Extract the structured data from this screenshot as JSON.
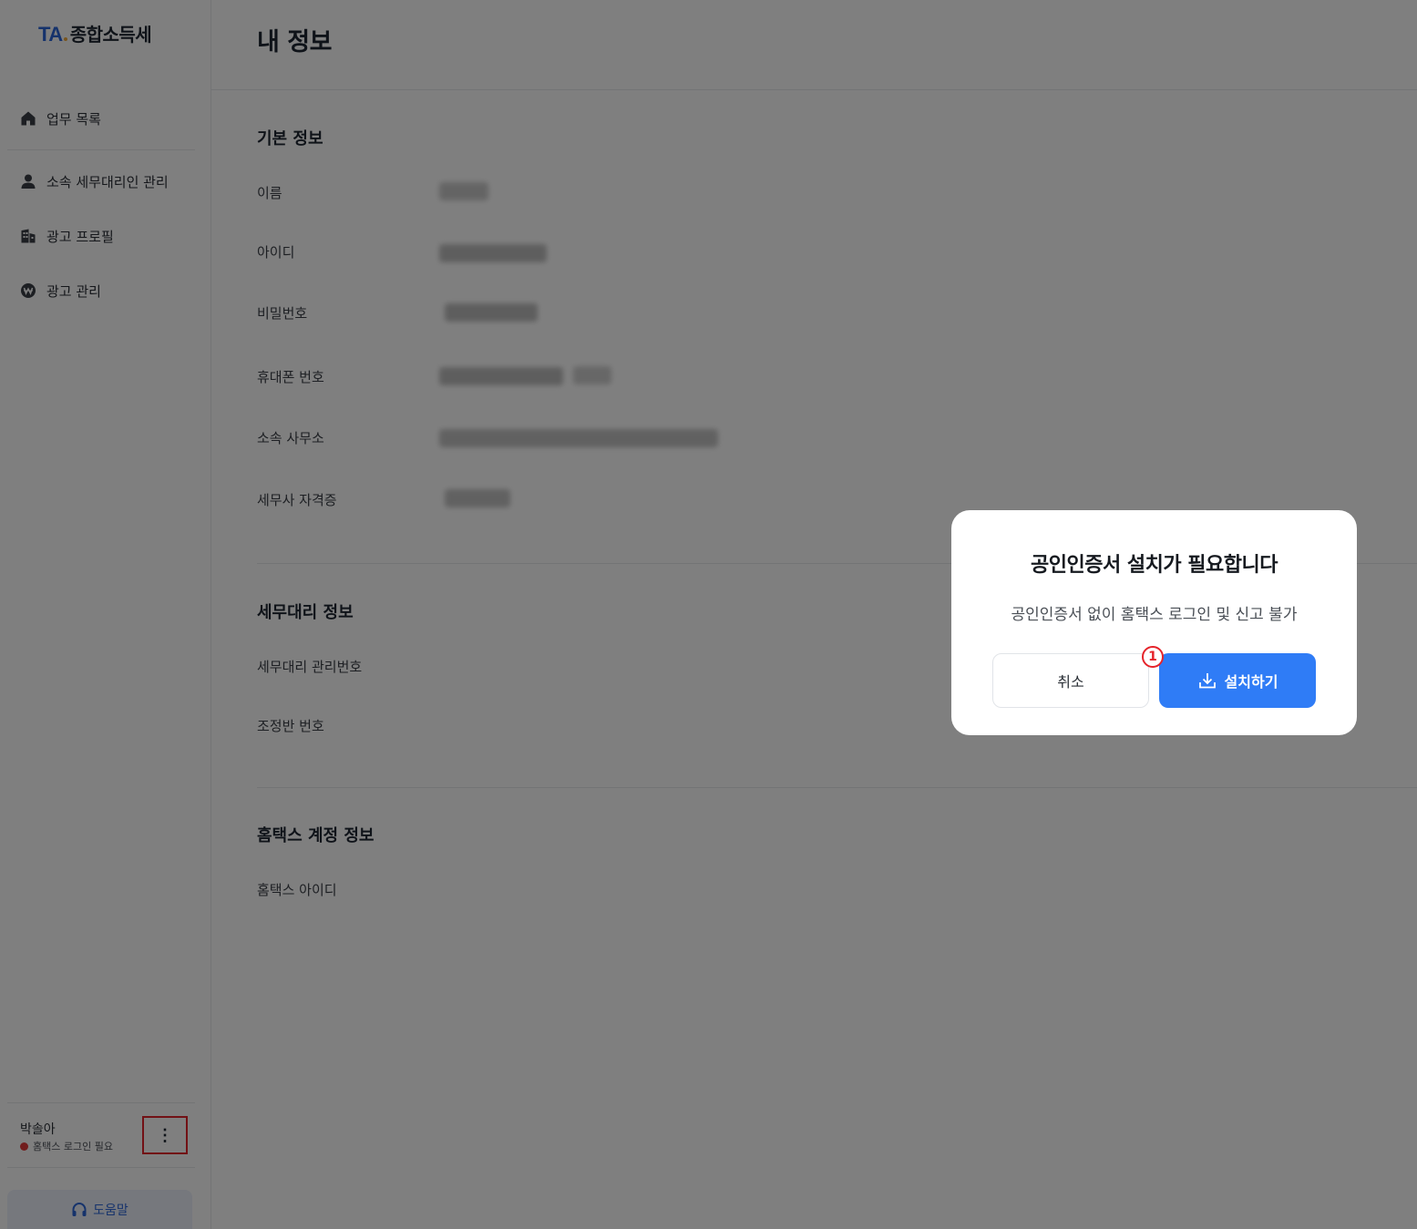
{
  "sidebar": {
    "logo_ta": "TA",
    "logo_name": "종합소득세",
    "items": [
      {
        "label": "업무 목록",
        "icon": "home-icon"
      },
      {
        "label": "소속 세무대리인 관리",
        "icon": "person-icon"
      },
      {
        "label": "광고 프로필",
        "icon": "building-icon"
      },
      {
        "label": "광고 관리",
        "icon": "won-coin-icon"
      }
    ],
    "user": {
      "name": "박솔아",
      "status": "홈택스 로그인 필요",
      "status_color": "#e23b3b",
      "more_icon": "⋮"
    },
    "help_label": "도움말"
  },
  "main": {
    "page_title": "내 정보",
    "sections": [
      {
        "title": "기본 정보",
        "fields": [
          {
            "label": "이름"
          },
          {
            "label": "아이디"
          },
          {
            "label": "비밀번호"
          },
          {
            "label": "휴대폰 번호"
          },
          {
            "label": "소속 사무소"
          },
          {
            "label": "세무사 자격증"
          }
        ]
      },
      {
        "title": "세무대리 정보",
        "fields": [
          {
            "label": "세무대리 관리번호"
          },
          {
            "label": "조정반 번호"
          }
        ]
      },
      {
        "title": "홈택스 계정 정보",
        "fields": [
          {
            "label": "홈택스 아이디"
          }
        ]
      }
    ]
  },
  "modal": {
    "title": "공인인증서 설치가 필요합니다",
    "description": "공인인증서 없이 홈택스 로그인 및 신고 불가",
    "cancel_label": "취소",
    "install_label": "설치하기",
    "install_icon": "download-icon",
    "step_badge": "1",
    "accent_color": "#2f7cf6"
  }
}
